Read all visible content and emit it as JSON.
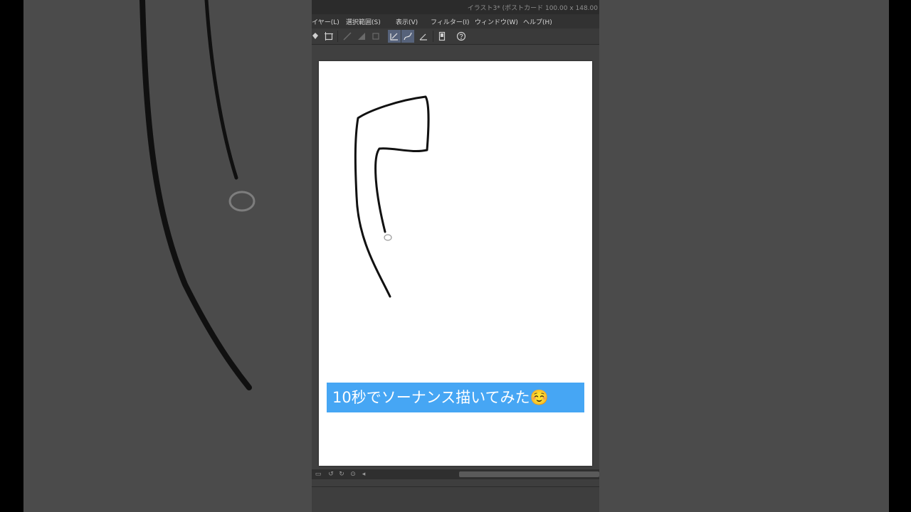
{
  "window": {
    "title": "イラスト3* (ポストカード 100.00 x 148.00"
  },
  "menu": [
    {
      "label": "イヤー(L)"
    },
    {
      "label": "選択範囲(S)"
    },
    {
      "label": "表示(V)"
    },
    {
      "label": "フィルター(I)"
    },
    {
      "label": "ウィンドウ(W)"
    },
    {
      "label": "ヘルプ(H)"
    }
  ],
  "toolbar": {
    "tools": [
      "fill-icon",
      "transform-icon",
      "snap-ruler-icon",
      "snap-grid-icon",
      "snap-special-icon",
      "pen-stroke-icon",
      "curve-stroke-icon",
      "angle-ruler-icon",
      "device-icon",
      "help-icon"
    ],
    "active": [
      "pen-stroke-icon",
      "curve-stroke-icon"
    ]
  },
  "caption": {
    "text": "10秒でソーナンス描いてみた☺️"
  },
  "colors": {
    "caption_bg": "#46a6f4",
    "active_tool": "#56627a",
    "paper": "#ffffff",
    "app_bg": "#3b3b3b"
  }
}
